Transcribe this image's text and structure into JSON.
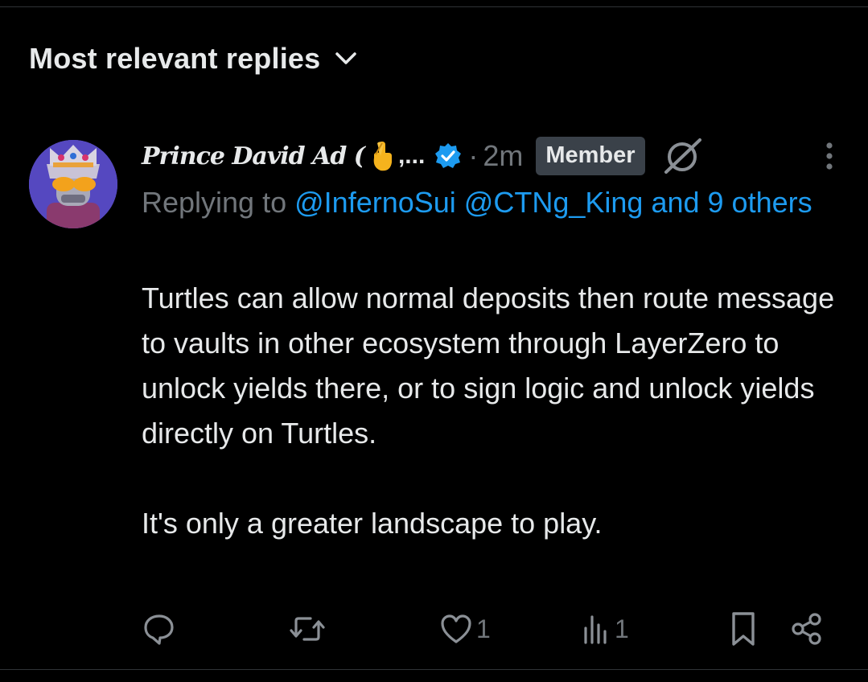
{
  "sort": {
    "label": "Most relevant replies",
    "icon": "chevron-down-icon"
  },
  "reply": {
    "author_name": "Prince David Ad (",
    "author_emoji": "crossed-fingers-emoji",
    "author_ellipsis": ",...",
    "verified_icon": "verified-badge-icon",
    "separator": "·",
    "timestamp": "2m",
    "badge": "Member",
    "replying_prefix": "Replying to",
    "mentions": [
      "@InfernoSui",
      "@CTNg_King"
    ],
    "others": "and 9 others",
    "paragraphs": [
      "Turtles can allow normal deposits then route message to vaults in other ecosystem through LayerZero to unlock yields there, or to sign logic and unlock yields directly on Turtles.",
      "It's only a greater landscape to play."
    ],
    "actions": {
      "reply_count": "",
      "repost_count": "",
      "like_count": "1",
      "views_count": "1"
    }
  },
  "colors": {
    "background": "#000000",
    "text": "#e7e9ea",
    "muted": "#71767b",
    "accent": "#1d9bf0",
    "badge_bg": "#3a4149"
  }
}
